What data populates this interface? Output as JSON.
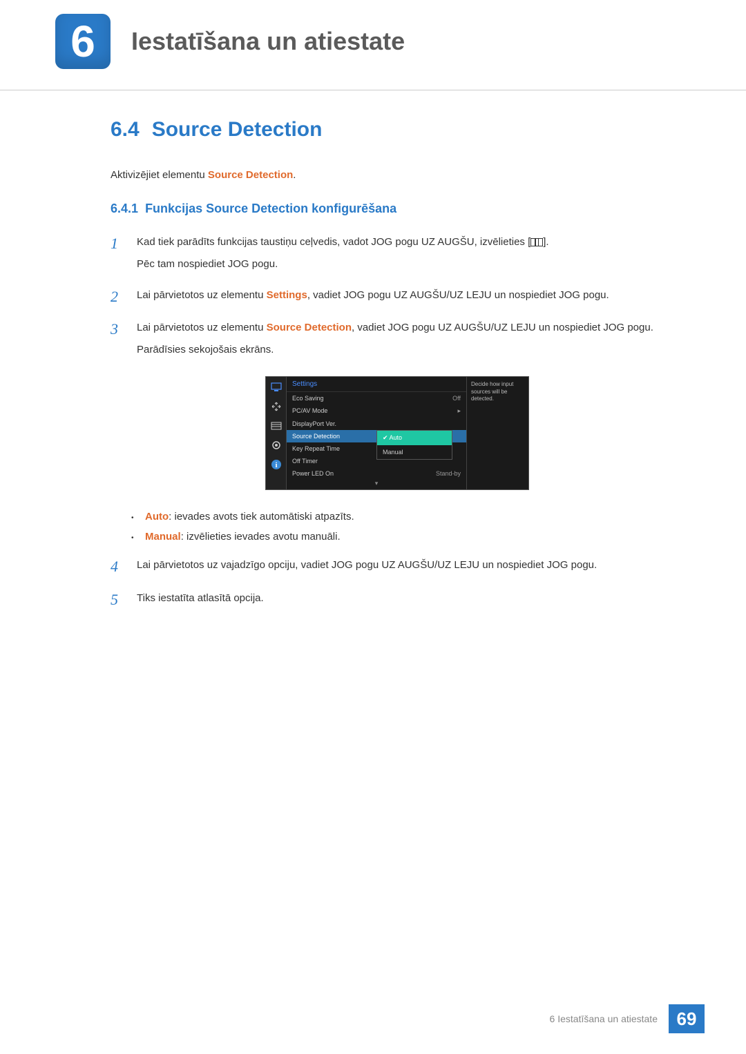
{
  "chapter": {
    "number": "6",
    "title": "Iestatīšana un atiestate"
  },
  "section": {
    "number": "6.4",
    "title": "Source Detection"
  },
  "intro": {
    "prefix": "Aktivizējiet elementu ",
    "keyword": "Source Detection",
    "suffix": "."
  },
  "subsection": {
    "number": "6.4.1",
    "title": "Funkcijas Source Detection konfigurēšana"
  },
  "steps": {
    "s1": {
      "num": "1",
      "line1a": "Kad tiek parādīts funkcijas taustiņu ceļvedis, vadot JOG pogu UZ AUGŠU, izvēlieties [",
      "line1b": "].",
      "line2": "Pēc tam nospiediet JOG pogu."
    },
    "s2": {
      "num": "2",
      "a": "Lai pārvietotos uz elementu ",
      "kw": "Settings",
      "b": ", vadiet JOG pogu UZ AUGŠU/UZ LEJU un nospiediet JOG pogu."
    },
    "s3": {
      "num": "3",
      "a": "Lai pārvietotos uz elementu ",
      "kw": "Source Detection",
      "b": ", vadiet JOG pogu UZ AUGŠU/UZ LEJU un nospiediet JOG pogu.",
      "line2": "Parādīsies sekojošais ekrāns."
    },
    "s4": {
      "num": "4",
      "text": "Lai pārvietotos uz vajadzīgo opciju, vadiet JOG pogu UZ AUGŠU/UZ LEJU un nospiediet JOG pogu."
    },
    "s5": {
      "num": "5",
      "text": "Tiks iestatīta atlasītā opcija."
    }
  },
  "osd": {
    "title": "Settings",
    "help": "Decide how input sources will be detected.",
    "rows": {
      "r1": {
        "label": "Eco Saving",
        "val": "Off"
      },
      "r2": {
        "label": "PC/AV Mode",
        "val": "▸"
      },
      "r3": {
        "label": "DisplayPort Ver.",
        "val": ""
      },
      "r4": {
        "label": "Source Detection",
        "val": ""
      },
      "r5": {
        "label": "Key Repeat Time",
        "val": ""
      },
      "r6": {
        "label": "Off Timer",
        "val": ""
      },
      "r7": {
        "label": "Power LED On",
        "val": "Stand-by"
      }
    },
    "popup": {
      "opt1": "Auto",
      "opt2": "Manual"
    }
  },
  "bullets": {
    "b1": {
      "kw": "Auto",
      "text": ": ievades avots tiek automātiski atpazīts."
    },
    "b2": {
      "kw": "Manual",
      "text": ": izvēlieties ievades avotu manuāli."
    }
  },
  "footer": {
    "text": "6 Iestatīšana un atiestate",
    "page": "69"
  }
}
